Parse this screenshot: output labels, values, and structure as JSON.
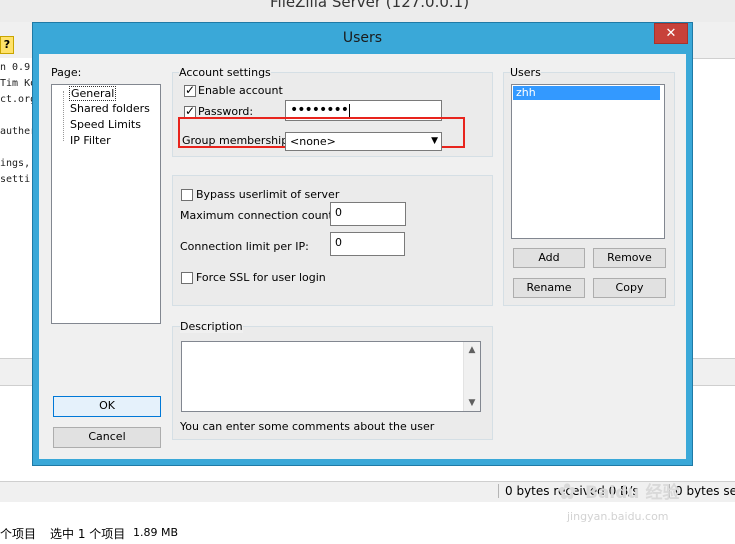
{
  "background_app": {
    "title": "FileZilla Server (127.0.0.1)",
    "toolbar_icon": "?",
    "log_lines": [
      "n 0.9.",
      "Tim Ko",
      "ct.org",
      "",
      "auther",
      "",
      "ings, ",
      " setti"
    ],
    "status_received": "0 bytes received  0 B/s",
    "status_sent": "0 bytes se",
    "explorer_items": "个项目",
    "explorer_selected": "选中 1 个项目",
    "explorer_size": "1.89 MB"
  },
  "dialog": {
    "title": "Users",
    "close_glyph": "✕",
    "page_label": "Page:",
    "pages": [
      "General",
      "Shared folders",
      "Speed Limits",
      "IP Filter"
    ],
    "account_settings": {
      "title": "Account settings",
      "enable_account_label": "Enable account",
      "enable_account_checked": true,
      "password_label": "Password:",
      "password_checked": true,
      "password_value": "••••••••",
      "group_label": "Group membership:",
      "group_value": "<none>"
    },
    "limits": {
      "bypass_label": "Bypass userlimit of server",
      "bypass_checked": false,
      "max_conn_label": "Maximum connection count:",
      "max_conn_value": "0",
      "conn_ip_label": "Connection limit per IP:",
      "conn_ip_value": "0",
      "force_ssl_label": "Force SSL for user login",
      "force_ssl_checked": false
    },
    "users": {
      "title": "Users",
      "items": [
        "zhh"
      ],
      "add_label": "Add",
      "remove_label": "Remove",
      "rename_label": "Rename",
      "copy_label": "Copy"
    },
    "description": {
      "title": "Description",
      "text": "",
      "hint": "You can enter some comments about the user"
    },
    "ok_label": "OK",
    "cancel_label": "Cancel"
  },
  "watermark": {
    "text": "Baidu 经验",
    "sub": "jingyan.baidu.com"
  },
  "colors": {
    "dialog_frame": "#3aa8d8",
    "close_button": "#c7413a",
    "selection": "#3399ff",
    "highlight": "#e8241d"
  }
}
